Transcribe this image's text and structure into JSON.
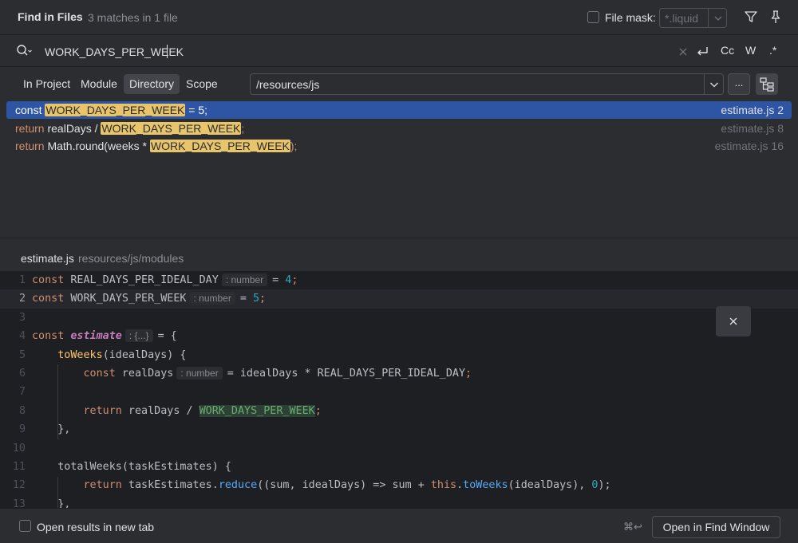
{
  "header": {
    "title": "Find in Files",
    "match_count": "3 matches in 1 file",
    "file_mask_label": "File mask:",
    "file_mask_value": "*.liquid"
  },
  "search": {
    "query": "WORK_DAYS_PER_WEEK",
    "opt_case": "Cc",
    "opt_words": "W",
    "opt_regex": ".*"
  },
  "scope": {
    "tabs": [
      {
        "label": "In Project",
        "active": false
      },
      {
        "label": "Module",
        "active": false
      },
      {
        "label": "Directory",
        "active": true
      },
      {
        "label": "Scope",
        "active": false
      }
    ],
    "directory": "/resources/js",
    "browse_label": "..."
  },
  "results": [
    {
      "prefix_kw": "const ",
      "prefix": "",
      "match": "WORK_DAYS_PER_WEEK",
      "suffix": " = 5;",
      "file": "estimate.js 2",
      "selected": true
    },
    {
      "prefix_kw": "return ",
      "prefix": "realDays / ",
      "match": "WORK_DAYS_PER_WEEK",
      "suffix": ";",
      "file": "estimate.js 8",
      "selected": false
    },
    {
      "prefix_kw": "return ",
      "prefix": "Math.round(weeks * ",
      "match": "WORK_DAYS_PER_WEEK",
      "suffix": ");",
      "file": "estimate.js 16",
      "selected": false
    }
  ],
  "preview": {
    "file_name": "estimate.js",
    "file_path": "resources/js/modules"
  },
  "code": {
    "line_numbers": [
      "1",
      "2",
      "3",
      "4",
      "5",
      "6",
      "7",
      "8",
      "9",
      "10",
      "11",
      "12",
      "13"
    ],
    "l1": {
      "kw": "const",
      "name": "REAL_DAYS_PER_IDEAL_DAY",
      "hint": ": number",
      "eq": "= ",
      "num": "4",
      "end": ";"
    },
    "l2": {
      "kw": "const",
      "name": "WORK_DAYS_PER_WEEK",
      "hint": ": number",
      "eq": "= ",
      "num": "5",
      "end": ";"
    },
    "l4": {
      "kw": "const",
      "name": "estimate",
      "hint": ": {...}",
      "rest": "= {"
    },
    "l5": {
      "method": "toWeeks",
      "rest": "(idealDays) {"
    },
    "l6": {
      "kw": "const",
      "name": "realDays",
      "hint": ": number",
      "rest": "= idealDays * REAL_DAYS_PER_IDEAL_DAY",
      "end": ";"
    },
    "l8": {
      "kw": "return",
      "rest": " realDays / ",
      "match": "WORK_DAYS_PER_WEEK",
      "end": ";"
    },
    "l9": {
      "text": "},"
    },
    "l11": {
      "method": "totalWeeks",
      "rest": "(taskEstimates) {"
    },
    "l12": {
      "kw": "return",
      "a": " taskEstimates.",
      "m1": "reduce",
      "b": "((sum, idealDays) => sum + ",
      "this": "this",
      "dot": ".",
      "m2": "toWeeks",
      "c": "(idealDays), ",
      "num": "0",
      "end": ");"
    },
    "l13": {
      "text": "},"
    }
  },
  "footer": {
    "new_tab_label": "Open results in new tab",
    "shortcut": "⌘↩",
    "open_button": "Open in Find Window"
  },
  "colors": {
    "selection": "#2e55a3",
    "match_highlight": "#e8c46a",
    "keyword": "#cf8e6d",
    "number": "#2aacb8"
  },
  "icons": [
    "filter-icon",
    "pin-icon",
    "search-history-icon",
    "clear-icon",
    "newline-icon",
    "chevron-down-icon",
    "tree-view-icon",
    "close-icon"
  ]
}
